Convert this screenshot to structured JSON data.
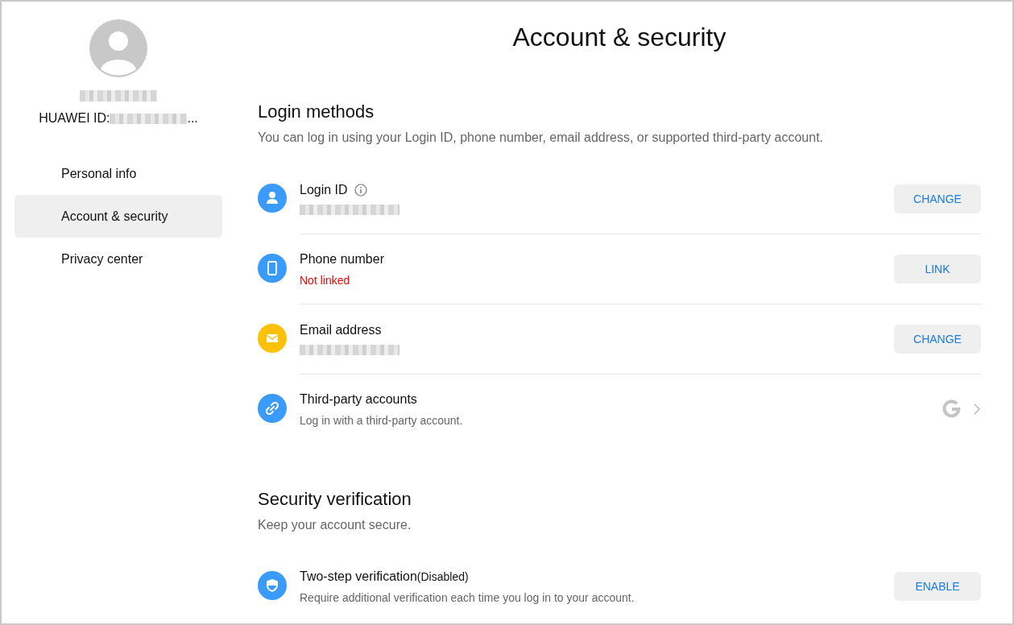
{
  "profile": {
    "name": {
      "kind": "redacted"
    },
    "id": {
      "prefix": "HUAWEI ID:",
      "hidden": true,
      "suffix": "..."
    }
  },
  "sidebar": {
    "items": [
      {
        "label": "Personal info",
        "selected": false
      },
      {
        "label": "Account & security",
        "selected": true
      },
      {
        "label": "Privacy center",
        "selected": false
      }
    ]
  },
  "title": "Account & security",
  "sections": [
    {
      "heading": "Login methods",
      "description": "You can log in using your Login ID, phone number, email address, or supported third-party account.",
      "rows": [
        {
          "kind": "person",
          "color": "#3a9bfc",
          "label": "Login ID",
          "info": true,
          "detail": {
            "kind": "redacted"
          },
          "action": {
            "kind": "button",
            "label": "CHANGE"
          }
        },
        {
          "kind": "phone",
          "color": "#3a9bfc",
          "label": "Phone number",
          "detail": {
            "kind": "warning",
            "text": "Not linked"
          },
          "action": {
            "kind": "button",
            "label": "LINK"
          }
        },
        {
          "kind": "mail",
          "color": "#ffc107",
          "label": "Email address",
          "detail": {
            "kind": "redacted"
          },
          "action": {
            "kind": "button",
            "label": "CHANGE"
          }
        },
        {
          "kind": "link",
          "color": "#3a9bfc",
          "label": "Third-party accounts",
          "detail": {
            "kind": "note",
            "text": "Log in with a third-party account."
          },
          "action": {
            "kind": "chevron"
          }
        }
      ]
    },
    {
      "heading": "Security verification",
      "description": "Keep your account secure.",
      "rows": [
        {
          "kind": "shield",
          "color": "#3a9bfc",
          "label": "Two-step verification",
          "status": "(Disabled)",
          "detail": {
            "kind": "note",
            "text": "Require additional verification each time you log in to your account."
          },
          "action": {
            "kind": "button",
            "label": "ENABLE"
          }
        }
      ]
    }
  ]
}
